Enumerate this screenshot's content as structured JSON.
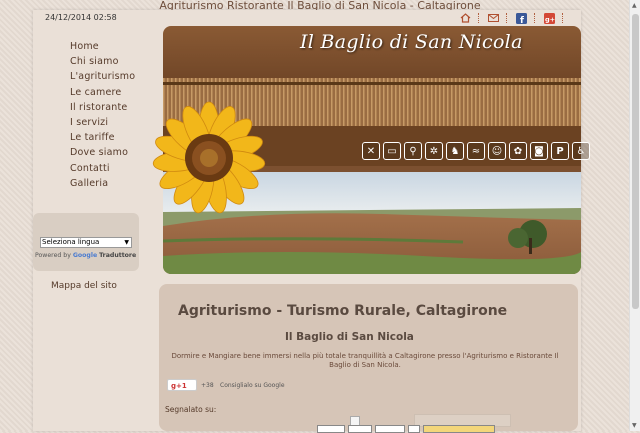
{
  "window": {
    "title": "Agriturismo Ristorante Il Baglio di San Nicola - Caltagirone"
  },
  "header": {
    "datetime": "24/12/2014 02:58",
    "icons": [
      "home-icon",
      "mail-icon",
      "facebook-icon",
      "google-plus-icon"
    ]
  },
  "nav": {
    "items": [
      "Home",
      "Chi siamo",
      "L'agriturismo",
      "Le camere",
      "Il ristorante",
      "I servizi",
      "Le tariffe",
      "Dove siamo",
      "Contatti",
      "Galleria"
    ]
  },
  "translate": {
    "select_value": "Seleziona lingua",
    "powered_by": "Powered by",
    "google": "Google",
    "service": "Traduttore"
  },
  "sitemap": {
    "label": "Mappa del sito"
  },
  "banner": {
    "title": "Il Baglio di San Nicola",
    "service_icons": [
      "restaurant-icon",
      "bed-icon",
      "bike-icon",
      "air-conditioning-icon",
      "horse-icon",
      "pool-icon",
      "kids-icon",
      "pets-icon",
      "camera-icon",
      "parking-icon",
      "disabled-access-icon"
    ],
    "parking_letter": "P"
  },
  "content": {
    "heading": "Agriturismo - Turismo Rurale, Caltagirone",
    "subheading": "Il Baglio di San Nicola",
    "description": "Dormire e Mangiare bene immersi nella più totale tranquillità a Caltagirone presso l'Agriturismo e Ristorante Il Baglio di San Nicola.",
    "gplus_label": "g+1",
    "gplus_count": "+38",
    "gplus_text": "Consiglialo su Google",
    "segnalato": "Segnalato su:"
  },
  "colors": {
    "background": "#e9dfd6",
    "text_brown": "#553a2a",
    "content_bg": "#d6c5b7"
  }
}
